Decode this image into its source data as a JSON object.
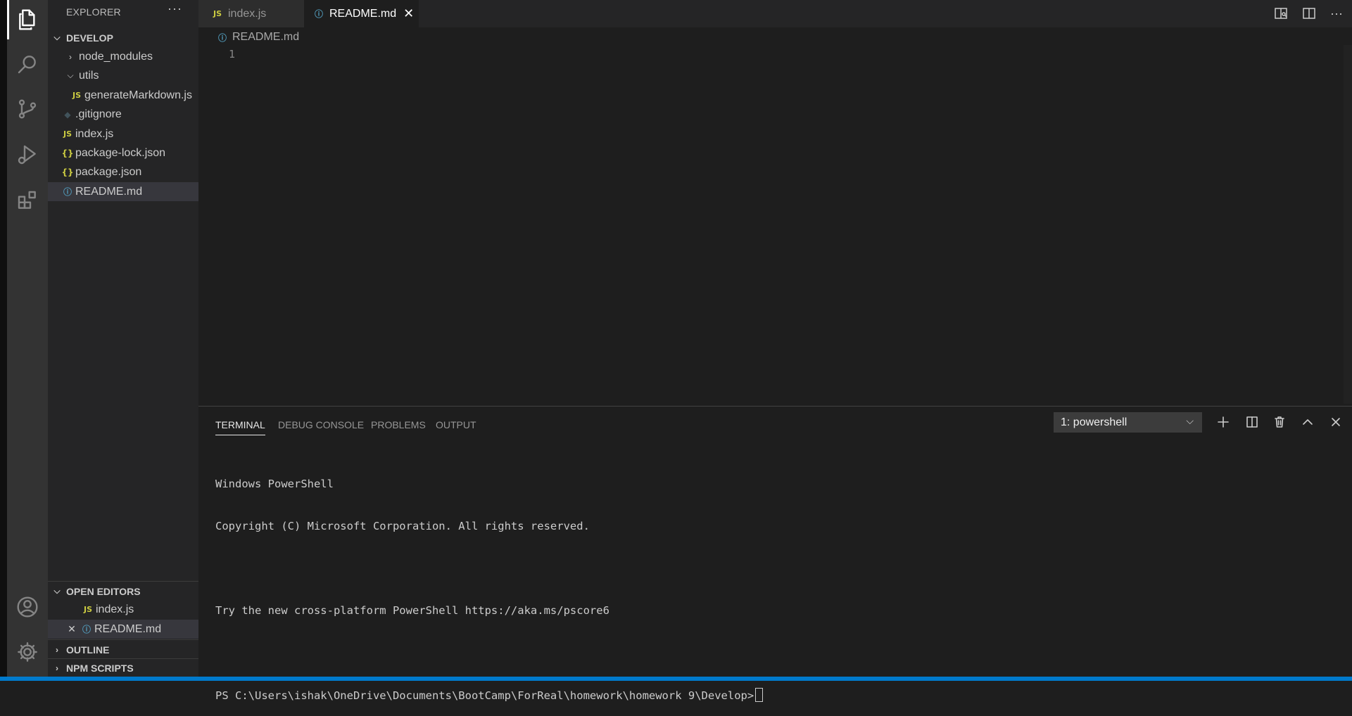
{
  "activity_bar": {
    "items": [
      {
        "icon": "files-icon",
        "active": true
      },
      {
        "icon": "search-icon",
        "active": false
      },
      {
        "icon": "source-control-icon",
        "active": false
      },
      {
        "icon": "run-debug-icon",
        "active": false
      },
      {
        "icon": "extensions-icon",
        "active": false
      }
    ],
    "bottom": [
      {
        "icon": "account-icon"
      },
      {
        "icon": "gear-icon"
      }
    ]
  },
  "sidebar": {
    "title": "EXPLORER",
    "more_label": "···",
    "workspace": {
      "name": "DEVELOP",
      "items": [
        {
          "label": "node_modules",
          "type": "folder",
          "expanded": false
        },
        {
          "label": "utils",
          "type": "folder",
          "expanded": true
        },
        {
          "label": "generateMarkdown.js",
          "type": "js",
          "icon_text": "JS"
        },
        {
          "label": ".gitignore",
          "type": "git",
          "icon_text": "◆"
        },
        {
          "label": "index.js",
          "type": "js",
          "icon_text": "JS"
        },
        {
          "label": "package-lock.json",
          "type": "json",
          "icon_text": "{}"
        },
        {
          "label": "package.json",
          "type": "json",
          "icon_text": "{}"
        },
        {
          "label": "README.md",
          "type": "md",
          "icon_text": "ⓘ",
          "selected": true
        }
      ]
    },
    "open_editors": {
      "title": "OPEN EDITORS",
      "items": [
        {
          "label": "index.js",
          "icon_text": "JS"
        },
        {
          "label": "README.md",
          "icon_text": "ⓘ",
          "close": "✕"
        }
      ]
    },
    "outline": {
      "title": "OUTLINE"
    },
    "npm_scripts": {
      "title": "NPM SCRIPTS"
    }
  },
  "tabs": [
    {
      "label": "index.js",
      "icon_text": "JS",
      "active": false
    },
    {
      "label": "README.md",
      "icon_text": "ⓘ",
      "active": true,
      "close": "✕"
    }
  ],
  "editor": {
    "breadcrumb": "README.md",
    "breadcrumb_icon": "ⓘ",
    "line_numbers": [
      "1"
    ]
  },
  "panel": {
    "tabs": [
      "TERMINAL",
      "DEBUG CONSOLE",
      "PROBLEMS",
      "OUTPUT"
    ],
    "active_tab": "TERMINAL",
    "terminal_select": "1: powershell",
    "terminal_lines": [
      "Windows PowerShell",
      "Copyright (C) Microsoft Corporation. All rights reserved.",
      "",
      "Try the new cross-platform PowerShell https://aka.ms/pscore6",
      "",
      "PS C:\\Users\\ishak\\OneDrive\\Documents\\BootCamp\\ForReal\\homework\\homework 9\\Develop>"
    ]
  },
  "colors": {
    "accent": "#007acc",
    "js_icon": "#cbcb41",
    "md_icon": "#519aba"
  }
}
